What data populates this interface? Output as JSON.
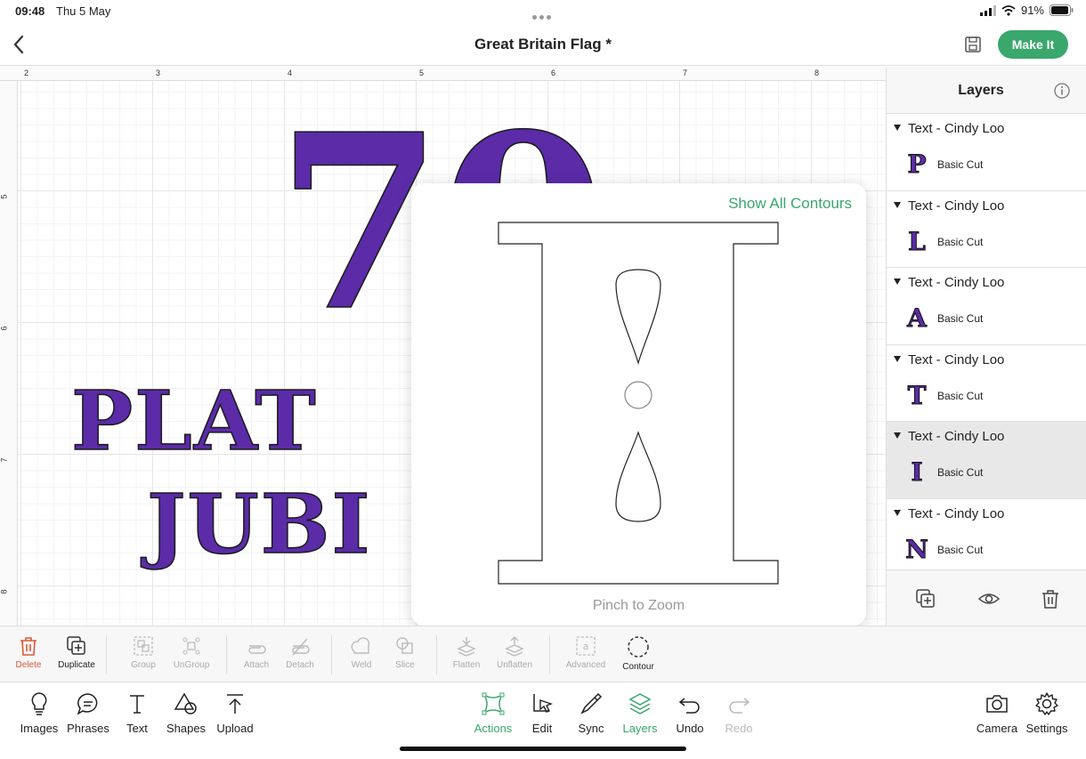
{
  "status": {
    "time": "09:48",
    "date": "Thu 5 May",
    "battery": "91%"
  },
  "header": {
    "title": "Great Britain Flag *",
    "make_it": "Make It"
  },
  "ruler": {
    "h_ticks": [
      "2",
      "3",
      "4",
      "5",
      "6",
      "7",
      "8"
    ],
    "v_ticks": [
      "5",
      "6",
      "7",
      "8"
    ]
  },
  "canvas": {
    "line1": "70",
    "line2": "PLAT",
    "line3": "JUBI"
  },
  "popover": {
    "show_all": "Show All Contours",
    "hint": "Pinch to Zoom"
  },
  "layers": {
    "title": "Layers",
    "groups": [
      {
        "title": "Text - Cindy Loo",
        "letter": "P",
        "op": "Basic Cut"
      },
      {
        "title": "Text - Cindy Loo",
        "letter": "L",
        "op": "Basic Cut"
      },
      {
        "title": "Text - Cindy Loo",
        "letter": "A",
        "op": "Basic Cut"
      },
      {
        "title": "Text - Cindy Loo",
        "letter": "T",
        "op": "Basic Cut"
      },
      {
        "title": "Text - Cindy Loo",
        "letter": "I",
        "op": "Basic Cut"
      },
      {
        "title": "Text - Cindy Loo",
        "letter": "N",
        "op": "Basic Cut"
      }
    ]
  },
  "edit_tools": {
    "delete": "Delete",
    "duplicate": "Duplicate",
    "group": "Group",
    "ungroup": "UnGroup",
    "attach": "Attach",
    "detach": "Detach",
    "weld": "Weld",
    "slice": "Slice",
    "flatten": "Flatten",
    "unflatten": "Unflatten",
    "advanced": "Advanced",
    "contour": "Contour"
  },
  "bottom_tools": {
    "images": "Images",
    "phrases": "Phrases",
    "text": "Text",
    "shapes": "Shapes",
    "upload": "Upload",
    "actions": "Actions",
    "edit": "Edit",
    "sync": "Sync",
    "layers": "Layers",
    "undo": "Undo",
    "redo": "Redo",
    "camera": "Camera",
    "settings": "Settings"
  },
  "colors": {
    "accent": "#3aa76d",
    "design": "#5b2ba8",
    "delete": "#e0573a"
  }
}
